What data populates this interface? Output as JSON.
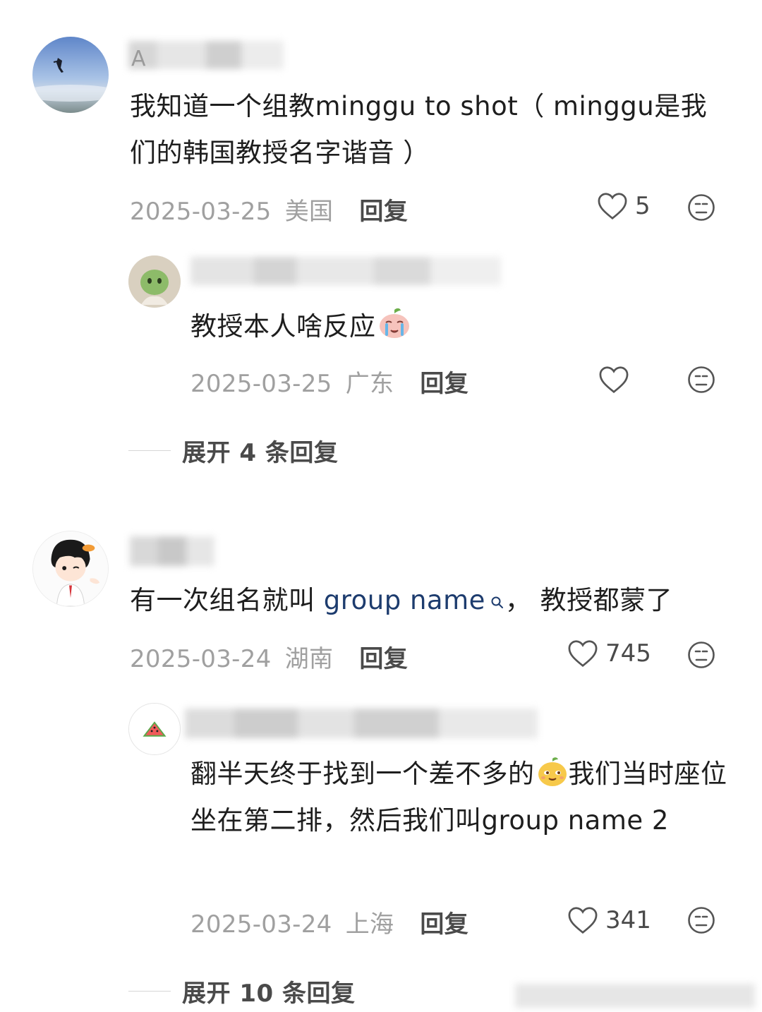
{
  "comments": [
    {
      "name_visible": "A",
      "text": "我知道一个组教minggu to shot（ minggu是我们的韩国教授名字谐音 ）",
      "date": "2025-03-25",
      "location": "美国",
      "reply_label": "回复",
      "likes": "5"
    },
    {
      "name_visible": "",
      "text_before": "有一次组名就叫 ",
      "link_text": "group name",
      "text_after": "， 教授都蒙了",
      "date": "2025-03-24",
      "location": "湖南",
      "reply_label": "回复",
      "likes": "745"
    }
  ],
  "replies": [
    {
      "text": "教授本人啥反应",
      "date": "2025-03-25",
      "location": "广东",
      "reply_label": "回复",
      "likes": ""
    },
    {
      "text_part1": "翻半天终于找到一个差不多的",
      "text_part2": "我们当时座位坐在第二排，然后我们叫group name 2",
      "date": "2025-03-24",
      "location": "上海",
      "reply_label": "回复",
      "likes": "341"
    }
  ],
  "expand": [
    {
      "label": "展开 4 条回复"
    },
    {
      "label": "展开 10 条回复"
    }
  ],
  "icons": {
    "like": "heart-outline-icon",
    "dislike": "neutral-face-icon",
    "search": "search-icon"
  },
  "colors": {
    "link": "#1d3c6e",
    "meta": "#a0a0a0",
    "text": "#1e1e1e"
  }
}
